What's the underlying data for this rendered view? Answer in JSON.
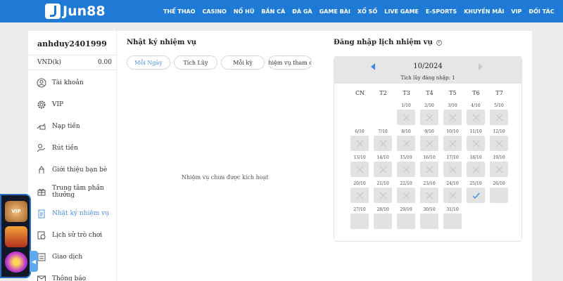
{
  "brand": {
    "name": "Jun88",
    "color": "#1f7ad6"
  },
  "nav": [
    "THỂ THAO",
    "CASINO",
    "NỔ HŨ",
    "BẮN CÁ",
    "ĐÁ GÀ",
    "GAME BÀI",
    "XỔ SỐ",
    "LIVE GAME",
    "E-SPORTS",
    "KHUYẾN MÃI",
    "VIP",
    "ĐỐI TÁC"
  ],
  "account": {
    "username": "anhduy2401999",
    "currency_label": "VND(k)",
    "balance": "0.00"
  },
  "sidebar": {
    "items": [
      {
        "label": "Tài khoản",
        "icon": "user-icon"
      },
      {
        "label": "VIP",
        "icon": "vip-gear-icon"
      },
      {
        "label": "Nạp tiền",
        "icon": "deposit-icon"
      },
      {
        "label": "Rút tiền",
        "icon": "withdraw-icon"
      },
      {
        "label": "Giới thiệu bạn bè",
        "icon": "refer-icon"
      },
      {
        "label": "Trung tâm phần thưởng",
        "icon": "gift-icon"
      },
      {
        "label": "Nhật ký nhiệm vụ",
        "icon": "task-log-icon",
        "active": true
      },
      {
        "label": "Lịch sử trò chơi",
        "icon": "history-icon"
      },
      {
        "label": "Giao dịch",
        "icon": "transaction-icon"
      },
      {
        "label": "Thông báo",
        "icon": "mail-icon"
      }
    ]
  },
  "floating": {
    "badge_text": "VIP"
  },
  "tasks": {
    "title": "Nhật ký nhiệm vụ",
    "tabs": [
      {
        "label": "Mỗi Ngày",
        "active": true
      },
      {
        "label": "Tích Lũy"
      },
      {
        "label": "Mỗi kỳ"
      },
      {
        "label": "Nhiệm vụ tham dự"
      }
    ],
    "empty_message": "Nhiệm vụ chưa được kích hoạt"
  },
  "checkin": {
    "title": "Đăng nhập lịch nhiệm vụ",
    "month": "10/2024",
    "accumulated": "Tích lũy đăng nhập: 1",
    "weekdays": [
      "CN",
      "T2",
      "T3",
      "T4",
      "T5",
      "T6",
      "T7"
    ],
    "days": [
      {
        "date": "1/10",
        "status": "missed"
      },
      {
        "date": "2/10",
        "status": "missed"
      },
      {
        "date": "3/10",
        "status": "missed"
      },
      {
        "date": "4/10",
        "status": "missed"
      },
      {
        "date": "5/10",
        "status": "missed"
      },
      {
        "date": "6/10",
        "status": "missed"
      },
      {
        "date": "7/10",
        "status": "missed"
      },
      {
        "date": "8/10",
        "status": "missed"
      },
      {
        "date": "9/10",
        "status": "missed"
      },
      {
        "date": "10/10",
        "status": "missed"
      },
      {
        "date": "11/10",
        "status": "missed"
      },
      {
        "date": "12/10",
        "status": "missed"
      },
      {
        "date": "13/10",
        "status": "missed"
      },
      {
        "date": "14/10",
        "status": "missed"
      },
      {
        "date": "15/10",
        "status": "missed"
      },
      {
        "date": "16/10",
        "status": "missed"
      },
      {
        "date": "17/10",
        "status": "missed"
      },
      {
        "date": "18/10",
        "status": "missed"
      },
      {
        "date": "19/10",
        "status": "missed"
      },
      {
        "date": "20/10",
        "status": "missed"
      },
      {
        "date": "21/10",
        "status": "missed"
      },
      {
        "date": "22/10",
        "status": "missed"
      },
      {
        "date": "23/10",
        "status": "missed"
      },
      {
        "date": "24/10",
        "status": "missed"
      },
      {
        "date": "25/10",
        "status": "checked"
      },
      {
        "date": "26/10",
        "status": "future"
      },
      {
        "date": "27/10",
        "status": "future"
      },
      {
        "date": "28/10",
        "status": "future"
      },
      {
        "date": "29/10",
        "status": "future"
      },
      {
        "date": "30/10",
        "status": "future"
      },
      {
        "date": "31/10",
        "status": "future"
      }
    ],
    "colors": {
      "checked": "#3a8ee6",
      "missed": "#c4c4c4"
    }
  }
}
